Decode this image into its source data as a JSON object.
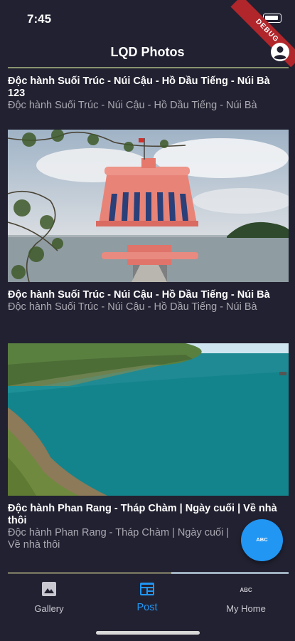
{
  "status_bar": {
    "time": "7:45",
    "debug_label": "DEBUG"
  },
  "app_bar": {
    "title": "LQD Photos",
    "account_icon": "account-circle-icon"
  },
  "feed": {
    "posts": [
      {
        "title": "Độc hành Suối Trúc - Núi Cậu - Hồ Dầu Tiếng - Núi Bà 123",
        "subtitle": "Độc hành Suối Trúc - Núi Cậu - Hồ Dầu Tiếng - Núi Bà"
      },
      {
        "title": "Độc hành Suối Trúc - Núi Cậu - Hồ Dầu Tiếng - Núi Bà",
        "subtitle": "Độc hành Suối Trúc - Núi Cậu - Hồ Dầu Tiếng - Núi Bà"
      },
      {
        "title": "Độc hành Phan Rang - Tháp Chàm | Ngày cuối | Về nhà thôi",
        "subtitle": "Độc hành Phan Rang - Tháp Chàm | Ngày cuối | Về nhà thôi"
      }
    ]
  },
  "fab": {
    "label": "ABC"
  },
  "bottom_nav": {
    "items": [
      {
        "label": "Gallery",
        "icon": "image-icon",
        "active": false
      },
      {
        "label": "Post",
        "icon": "article-icon",
        "active": true
      },
      {
        "label": "My Home",
        "icon": "abc-icon",
        "active": false
      }
    ]
  },
  "colors": {
    "background": "#222131",
    "accent": "#2196f3",
    "subtitle": "#a9a8b1",
    "debug": "#b0262b"
  }
}
